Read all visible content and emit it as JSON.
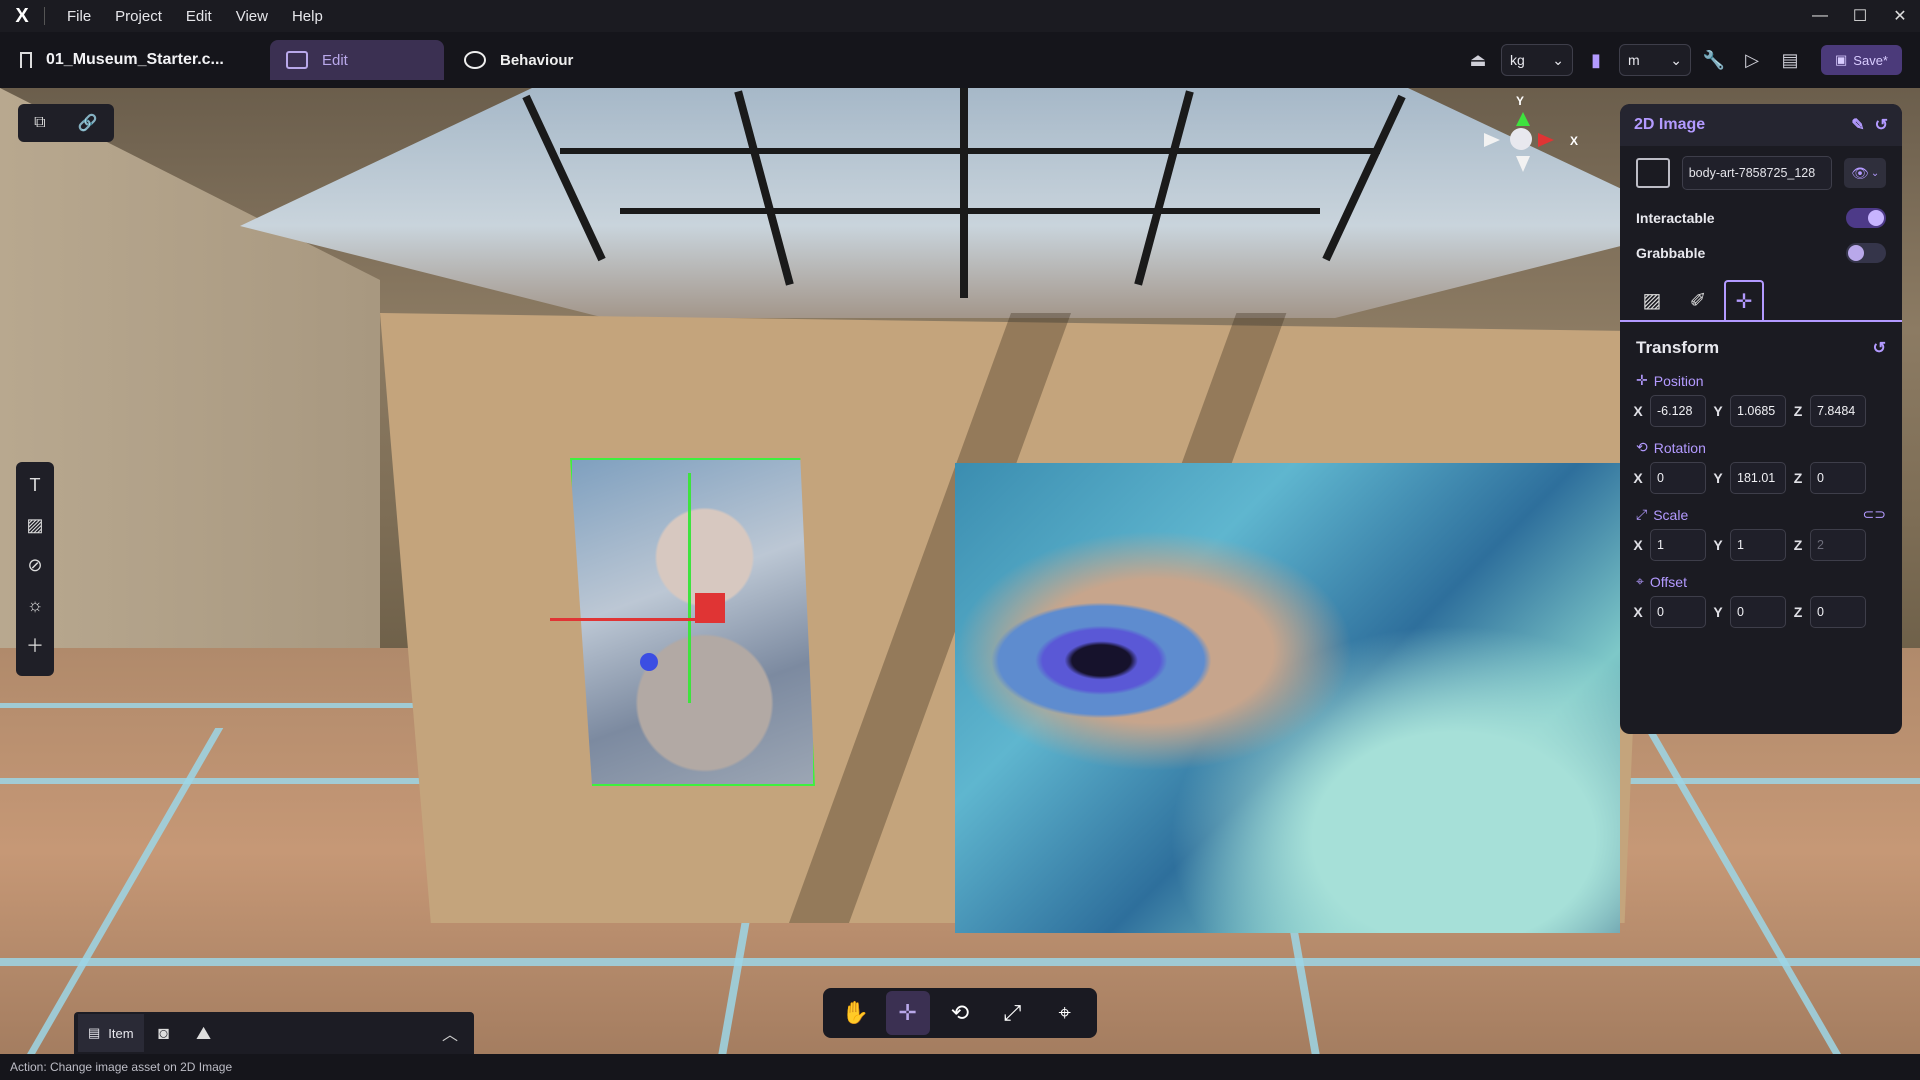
{
  "menubar": {
    "logo": "X",
    "items": [
      "File",
      "Project",
      "Edit",
      "View",
      "Help"
    ]
  },
  "toolbar": {
    "project_name": "01_Museum_Starter.c...",
    "tabs": [
      {
        "label": "Edit",
        "active": true
      },
      {
        "label": "Behaviour",
        "active": false
      }
    ],
    "mass_unit": "kg",
    "length_unit": "m",
    "save_label": "Save*"
  },
  "viewport": {
    "gizmo_axes": {
      "y": "Y",
      "x": "X"
    },
    "bottom_tools": [
      {
        "icon": "hand-icon",
        "glyph": "✋",
        "active": false
      },
      {
        "icon": "move-icon",
        "glyph": "✛",
        "active": true
      },
      {
        "icon": "rotate-icon",
        "glyph": "⟲",
        "active": false
      },
      {
        "icon": "scale-icon",
        "glyph": "⤢",
        "active": false
      },
      {
        "icon": "transform-icon",
        "glyph": "⌖",
        "active": false
      }
    ]
  },
  "tray": {
    "item_label": "Item"
  },
  "status": {
    "text": "Action: Change image asset on 2D Image"
  },
  "inspector": {
    "title": "2D Image",
    "asset_name": "body-art-7858725_128",
    "interactable_label": "Interactable",
    "interactable_on": true,
    "grabbable_label": "Grabbable",
    "grabbable_on": false,
    "transform_title": "Transform",
    "position": {
      "label": "Position",
      "x": "-6.128",
      "y": "1.0685",
      "z": "7.8484"
    },
    "rotation": {
      "label": "Rotation",
      "x": "0",
      "y": "181.01",
      "z": "0"
    },
    "scale": {
      "label": "Scale",
      "x": "1",
      "y": "1",
      "z": "2"
    },
    "offset": {
      "label": "Offset",
      "x": "0",
      "y": "0",
      "z": "0"
    },
    "axis_labels": {
      "x": "X",
      "y": "Y",
      "z": "Z"
    }
  },
  "colors": {
    "accent": "#b39aff",
    "selection": "#3ef03e",
    "axis_x": "#e03434",
    "axis_y": "#3ee33e",
    "axis_z": "#3b4ee3"
  }
}
